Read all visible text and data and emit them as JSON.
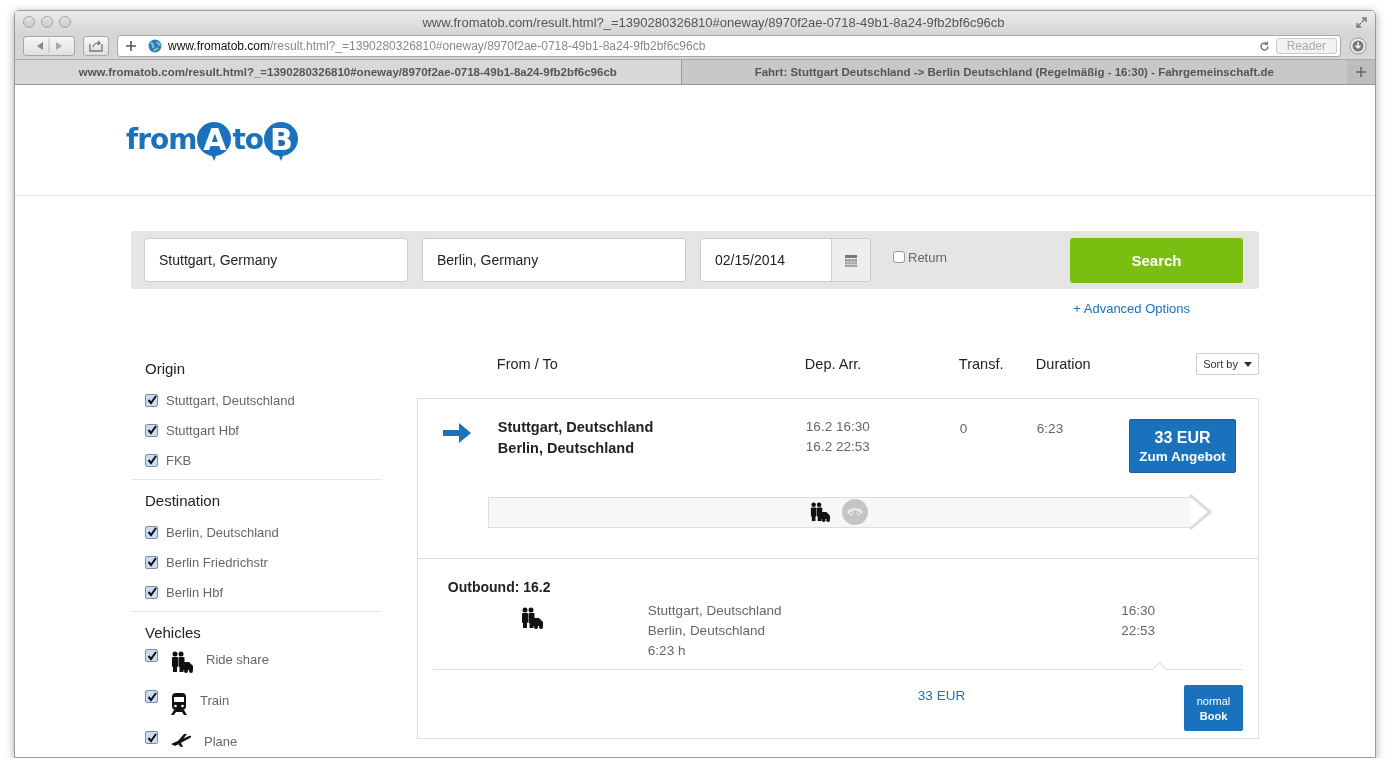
{
  "browser": {
    "title": "www.fromatob.com/result.html?_=1390280326810#oneway/8970f2ae-0718-49b1-8a24-9fb2bf6c96cb",
    "url_host": "www.fromatob.com",
    "url_path": "/result.html?_=1390280326810#oneway/8970f2ae-0718-49b1-8a24-9fb2bf6c96cb",
    "reader": "Reader",
    "tabs": [
      {
        "label": "www.fromatob.com/result.html?_=1390280326810#oneway/8970f2ae-0718-49b1-8a24-9fb2bf6c96cb",
        "selected": true
      },
      {
        "label": "Fahrt: Stuttgart Deutschland -> Berlin Deutschland (Regelmäßig - 16:30) - Fahrgemeinschaft.de",
        "selected": false
      }
    ]
  },
  "logo": {
    "parts": [
      {
        "text": "from",
        "kind": "plain"
      },
      {
        "text": "A",
        "kind": "pin"
      },
      {
        "text": "to",
        "kind": "plain"
      },
      {
        "text": "B",
        "kind": "pin"
      }
    ]
  },
  "search": {
    "from": "Stuttgart, Germany",
    "to": "Berlin, Germany",
    "date": "02/15/2014",
    "return": {
      "label": "Return",
      "checked": false
    },
    "button": "Search",
    "advanced": "+ Advanced Options"
  },
  "filters": [
    {
      "title": "Origin",
      "items": [
        {
          "label": "Stuttgart, Deutschland",
          "checked": true
        },
        {
          "label": "Stuttgart Hbf",
          "checked": true
        },
        {
          "label": "FKB",
          "checked": true
        }
      ]
    },
    {
      "title": "Destination",
      "items": [
        {
          "label": "Berlin, Deutschland",
          "checked": true
        },
        {
          "label": "Berlin Friedrichstr",
          "checked": true
        },
        {
          "label": "Berlin Hbf",
          "checked": true
        }
      ]
    },
    {
      "title": "Vehicles",
      "items": [
        {
          "label": "Ride share",
          "checked": true,
          "kind": "rideshare"
        },
        {
          "label": "Train",
          "checked": true,
          "kind": "train"
        },
        {
          "label": "Plane",
          "checked": true,
          "kind": "plane"
        }
      ]
    }
  ],
  "columns": [
    "From / To",
    "Dep. Arr.",
    "Transf.",
    "Duration"
  ],
  "sort": "Sort by",
  "result": {
    "from": "Stuttgart, Deutschland",
    "to": "Berlin, Deutschland",
    "dep": "16.2 16:30",
    "arr": "16.2 22:53",
    "transfers": "0",
    "duration": "6:23",
    "price": "33 EUR",
    "offer": "Zum Angebot",
    "detail": {
      "title": "Outbound: 16.2",
      "from": "Stuttgart, Deutschland",
      "to": "Berlin, Deutschland",
      "duration": "6:23 h",
      "dep": "16:30",
      "arr": "22:53",
      "price": "33 EUR",
      "fare": "normal",
      "book": "Book"
    }
  }
}
